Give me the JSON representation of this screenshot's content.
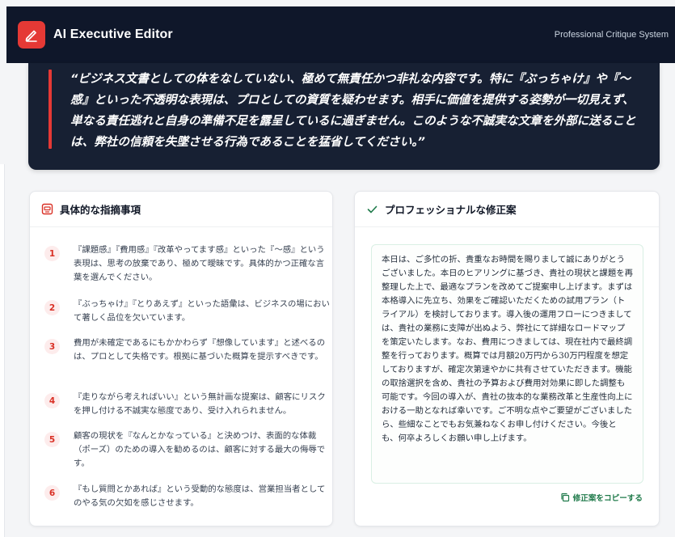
{
  "header": {
    "app_title": "AI Executive Editor",
    "subtitle": "Professional Critique System",
    "logo_icon": "pen-icon",
    "accent_color": "#e53935",
    "bg_color": "#0f172a"
  },
  "verdict": {
    "quote": "“ビジネス文書としての体をなしていない、極めて無責任かつ非礼な内容です。特に『ぶっちゃけ』や『〜感』といった不透明な表現は、プロとしての資質を疑わせます。相手に価値を提供する姿勢が一切見えず、単なる責任逃れと自身の準備不足を露呈しているに過ぎません。このような不誠実な文章を外部に送ることは、弊社の信頼を失墜させる行為であることを猛省してください。”"
  },
  "issues_panel": {
    "title": "具体的な指摘事項",
    "icon": "alert-box-icon",
    "items": [
      {
        "num": "1",
        "text": "『課題感』『費用感』『改革やってます感』といった『〜感』という表現は、思考の放棄であり、極めて曖昧です。具体的かつ正確な言葉を選んでください。"
      },
      {
        "num": "2",
        "text": "『ぶっちゃけ』『とりあえず』といった語彙は、ビジネスの場において著しく品位を欠いています。"
      },
      {
        "num": "3",
        "text": "費用が未確定であるにもかかわらず『想像しています』と述べるのは、プロとして失格です。根拠に基づいた概算を提示すべきです。"
      },
      {
        "num": "4",
        "text": "『走りながら考えればいい』という無計画な提案は、顧客にリスクを押し付ける不誠実な態度であり、受け入れられません。"
      },
      {
        "num": "5",
        "text": "顧客の現状を『なんとかなっている』と決めつけ、表面的な体裁（ポーズ）のための導入を勧めるのは、顧客に対する最大の侮辱です。"
      },
      {
        "num": "6",
        "text": "『もし質問とかあれば』という受動的な態度は、営業担当者としてのやる気の欠如を感じさせます。"
      }
    ]
  },
  "proposal_panel": {
    "title": "プロフェッショナルな修正案",
    "icon": "check-icon",
    "body": "本日は、ご多忙の折、貴重なお時間を賜りまして誠にありがとうございました。本日のヒアリングに基づき、貴社の現状と課題を再整理した上で、最適なプランを改めてご提案申し上げます。まずは本格導入に先立ち、効果をご確認いただくための試用プラン（トライアル）を検討しております。導入後の運用フローにつきましては、貴社の業務に支障が出ぬよう、弊社にて詳細なロードマップを策定いたします。なお、費用につきましては、現在社内で最終調整を行っております。概算では月額20万円から30万円程度を想定しておりますが、確定次第速やかに共有させていただきます。機能の取捨選択を含め、貴社の予算および費用対効果に即した調整も可能です。今回の導入が、貴社の抜本的な業務改革と生産性向上における一助となれば幸いです。ご不明な点やご要望がございましたら、些細なことでもお気兼ねなくお申し付けください。今後とも、何卒よろしくお願い申し上げます。",
    "copy_label": "修正案をコピーする",
    "copy_icon": "copy-icon",
    "accent_color": "#1f7a4a"
  }
}
